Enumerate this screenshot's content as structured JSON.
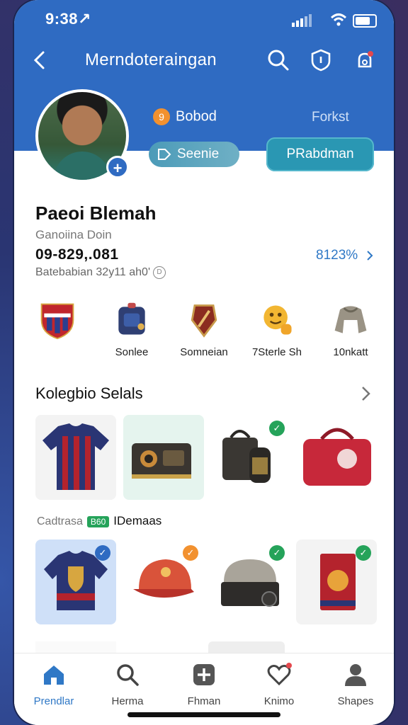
{
  "status": {
    "time": "9:38↗"
  },
  "header": {
    "title": "Merndoteraingan"
  },
  "profile": {
    "stat_left": "Bobod",
    "stat_left_icon": "9",
    "stat_right": "Forkst",
    "pill_left": "Seenie",
    "pill_right": "PRabdman",
    "name": "Paeoi Blemah",
    "subtitle": "Ganoiina Doin",
    "balance": "09-829,.081",
    "percent": "8123%",
    "meta": "Batebabian 32y11 ah0'"
  },
  "badges": [
    {
      "label": "",
      "icon": "crest-icon"
    },
    {
      "label": "Sonlee",
      "icon": "backpack-icon"
    },
    {
      "label": "Somneian",
      "icon": "emblem-icon"
    },
    {
      "label": "7Sterle Sh",
      "icon": "emoji-thumbs-icon"
    },
    {
      "label": "10nkatt",
      "icon": "jacket-icon"
    }
  ],
  "collection": {
    "title": "Kolegbio Selals",
    "mid_label_a": "Cadtrasa",
    "mid_badge": "B60",
    "mid_label_b": "IDemaas",
    "row1": [
      {
        "item": "jersey-icon"
      },
      {
        "item": "radio-icon"
      },
      {
        "item": "camera-bag-icon"
      },
      {
        "item": "duffel-bag-icon"
      }
    ],
    "row2": [
      {
        "item": "shirt-crest-icon"
      },
      {
        "item": "cap-icon"
      },
      {
        "item": "grill-icon"
      },
      {
        "item": "scarf-icon"
      }
    ]
  },
  "tabs": [
    {
      "label": "Prendlar",
      "icon": "home-icon"
    },
    {
      "label": "Herma",
      "icon": "search-icon"
    },
    {
      "label": "Fhman",
      "icon": "add-icon"
    },
    {
      "label": "Knimo",
      "icon": "heart-icon"
    },
    {
      "label": "Shapes",
      "icon": "profile-icon"
    }
  ],
  "colors": {
    "brand": "#2f6bc2",
    "accent": "#2a97b3",
    "link": "#2f78c6",
    "success": "#25a35a",
    "orange": "#f2912f"
  }
}
